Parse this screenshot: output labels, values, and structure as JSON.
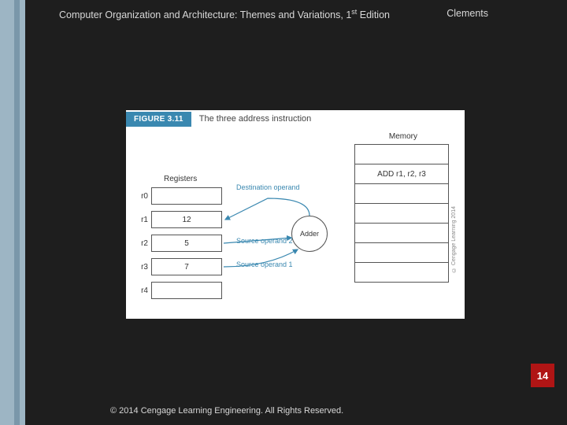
{
  "header": {
    "title_pre": "Computer Organization and Architecture: Themes and Variations, 1",
    "title_sup": "st",
    "title_post": " Edition",
    "author": "Clements"
  },
  "figure": {
    "tag": "FIGURE 3.11",
    "caption": "The three address instruction",
    "memory_label": "Memory",
    "memory_cells": [
      "",
      "ADD r1, r2, r3",
      "",
      "",
      "",
      "",
      ""
    ],
    "registers_label": "Registers",
    "registers": [
      {
        "name": "r0",
        "value": ""
      },
      {
        "name": "r1",
        "value": "12"
      },
      {
        "name": "r2",
        "value": "5"
      },
      {
        "name": "r3",
        "value": "7"
      },
      {
        "name": "r4",
        "value": ""
      }
    ],
    "labels": {
      "dest": "Destination\noperand",
      "src2": "Source\noperand 2",
      "src1": "Source\noperand 1",
      "adder": "Adder"
    },
    "side_copyright": "© Cengage Learning 2014"
  },
  "page_number": "14",
  "footer": "© 2014 Cengage Learning Engineering. All Rights Reserved."
}
